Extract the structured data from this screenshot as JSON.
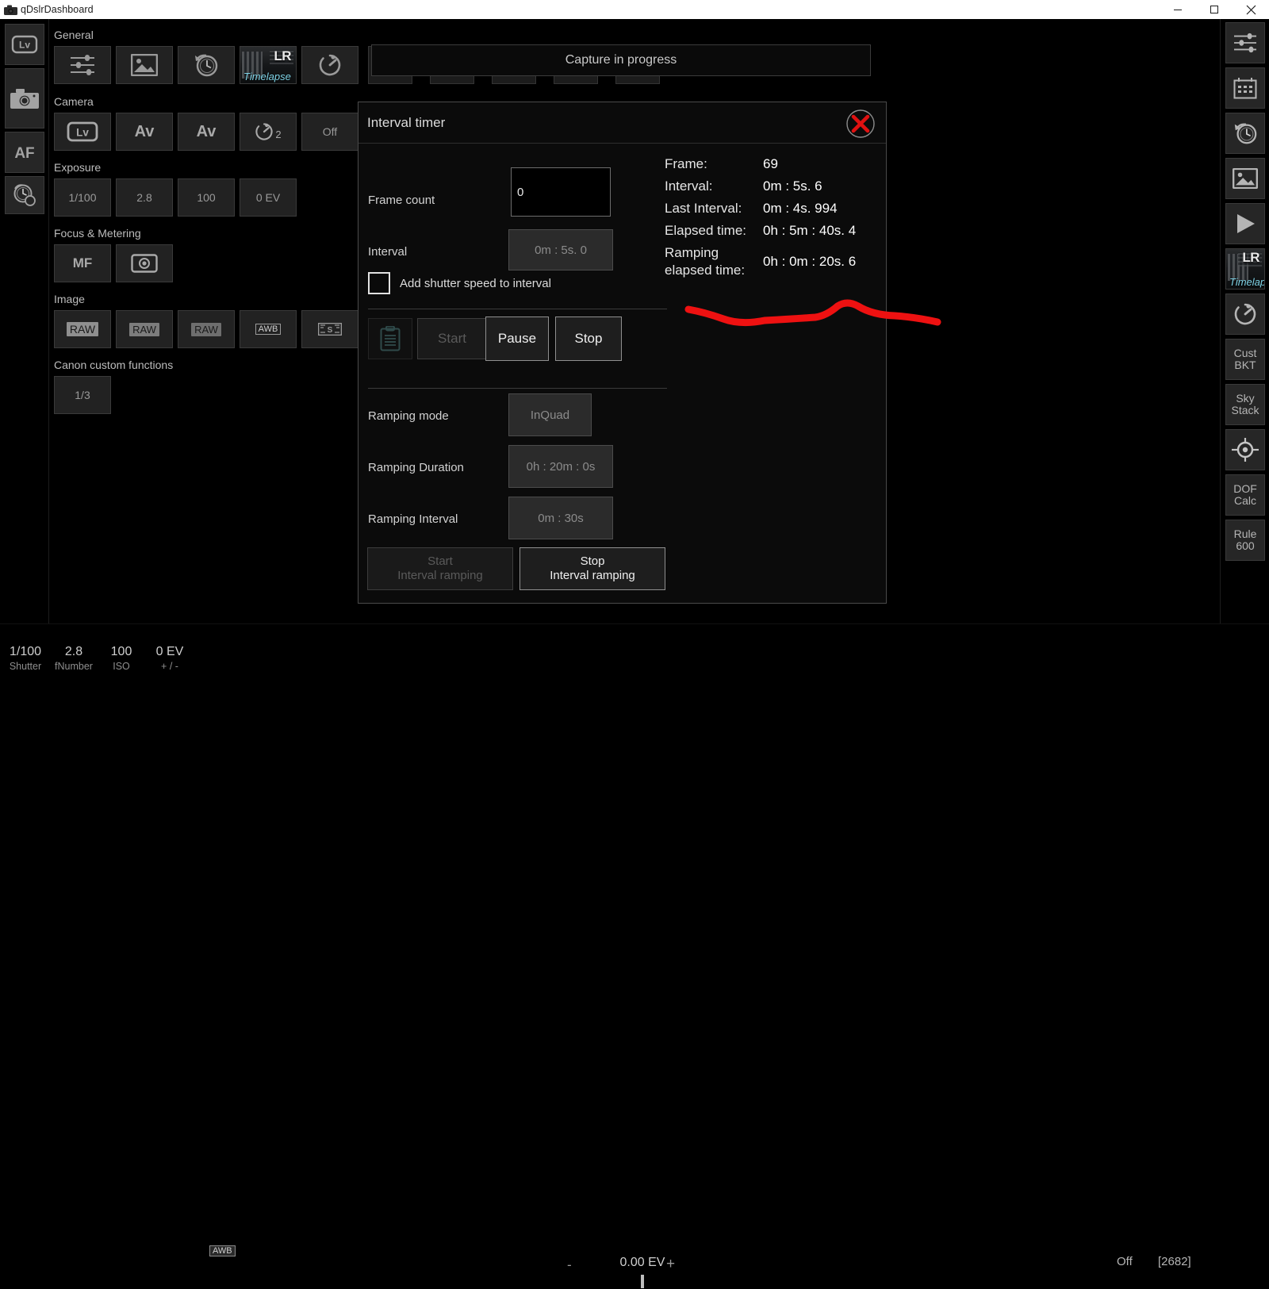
{
  "window": {
    "title": "qDslrDashboard",
    "icon": "camera-icon",
    "minimize": "─",
    "maximize": "❐",
    "close": "✕"
  },
  "banner": {
    "text": "Capture in progress"
  },
  "left_rail": [
    {
      "name": "lv-toggle",
      "label": "Lv",
      "icon": "lv-icon"
    },
    {
      "name": "camera-mode",
      "label": "",
      "icon": "camera-icon"
    },
    {
      "name": "af-toggle",
      "label": "AF",
      "icon": "af-icon"
    },
    {
      "name": "interval-timer",
      "label": "",
      "icon": "timer-clock-icon"
    }
  ],
  "groups": [
    {
      "label": "General",
      "tiles": [
        {
          "name": "sliders-tile",
          "label": "",
          "icon": "sliders-icon"
        },
        {
          "name": "gallery-tile",
          "label": "",
          "icon": "image-icon"
        },
        {
          "name": "interval-timer-tile",
          "label": "",
          "icon": "clock-arrow-icon"
        },
        {
          "name": "lrtimelapse-tile",
          "label": "LR",
          "sublabel": "Timelapse",
          "icon": "lrtimelapse-icon"
        },
        {
          "name": "self-timer-tile",
          "label": "",
          "icon": "self-timer-icon"
        }
      ]
    },
    {
      "label": "Camera",
      "tiles": [
        {
          "name": "liveview-tile",
          "label": "Lv",
          "icon": "lv-icon"
        },
        {
          "name": "mode-tile",
          "label": "Av"
        },
        {
          "name": "exposure-mode-tile",
          "label": "Av"
        },
        {
          "name": "drive-mode-tile",
          "label": "2",
          "icon": "self-timer-icon"
        },
        {
          "name": "aeb-tile",
          "label": "Off"
        }
      ]
    },
    {
      "label": "Exposure",
      "tiles": [
        {
          "name": "shutter-tile",
          "label": "1/100"
        },
        {
          "name": "aperture-tile",
          "label": "2.8"
        },
        {
          "name": "iso-tile",
          "label": "100"
        },
        {
          "name": "exposure-comp-tile",
          "label": "0 EV"
        }
      ]
    },
    {
      "label": "Focus & Metering",
      "tiles": [
        {
          "name": "focus-mode-tile",
          "label": "MF"
        },
        {
          "name": "metering-mode-tile",
          "label": "",
          "icon": "metering-icon"
        }
      ]
    },
    {
      "label": "Image",
      "tiles": [
        {
          "name": "image-quality-tile",
          "label": "RAW"
        },
        {
          "name": "image-quality2-tile",
          "label": "RAW"
        },
        {
          "name": "image-quality3-tile",
          "label": "RAW"
        },
        {
          "name": "white-balance-tile",
          "label": "AWB"
        },
        {
          "name": "picture-style-tile",
          "label": "",
          "icon": "picture-style-icon"
        }
      ]
    },
    {
      "label": "Canon custom functions",
      "tiles": [
        {
          "name": "custom-function-tile",
          "label": "1/3"
        }
      ]
    }
  ],
  "quick_tiles": [
    {
      "name": "cust-bkt-tile",
      "line1": "Cust",
      "line2": "BKT"
    },
    {
      "name": "sky-stack-tile",
      "line1": "Sky",
      "line2": "Stack"
    },
    {
      "name": "rule-600-tile",
      "line1": "Rule",
      "line2": "600"
    },
    {
      "name": "dof-calc-tile",
      "line1": "DOF",
      "line2": "Calc"
    },
    {
      "name": "audio-trigger-tile",
      "line1": "",
      "line2": "",
      "icon": "microphone-icon"
    }
  ],
  "right_rail": [
    {
      "name": "sliders-button",
      "line1": "",
      "line2": "",
      "icon": "sliders-icon"
    },
    {
      "name": "calendar-button",
      "line1": "",
      "line2": "",
      "icon": "calendar-icon"
    },
    {
      "name": "interval-timer-button",
      "line1": "",
      "line2": "",
      "icon": "clock-arrow-icon"
    },
    {
      "name": "gallery-button",
      "line1": "",
      "line2": "",
      "icon": "image-icon"
    },
    {
      "name": "play-button",
      "line1": "",
      "line2": "",
      "icon": "play-icon"
    },
    {
      "name": "lrtimelapse-button",
      "line1": "LR",
      "line2": "Timelapse",
      "icon": "lrtimelapse-icon"
    },
    {
      "name": "self-timer-button",
      "line1": "",
      "line2": "",
      "icon": "self-timer-icon"
    },
    {
      "name": "cust-bkt-button",
      "line1": "Cust",
      "line2": "BKT"
    },
    {
      "name": "sky-stack-button",
      "line1": "Sky",
      "line2": "Stack"
    },
    {
      "name": "focus-target-button",
      "line1": "",
      "line2": "",
      "icon": "crosshair-icon"
    },
    {
      "name": "dof-calc-button",
      "line1": "DOF",
      "line2": "Calc"
    },
    {
      "name": "rule-600-button",
      "line1": "Rule",
      "line2": "600"
    }
  ],
  "dialog": {
    "title": "Interval timer",
    "close_icon": "close-circle-icon",
    "frame_count": {
      "label": "Frame count",
      "value": "0",
      "placeholder": "0"
    },
    "interval": {
      "label": "Interval",
      "value": "0m : 5s. 0"
    },
    "add_shutter": {
      "label": "Add shutter speed to interval",
      "checked": false
    },
    "list_icon": "clipboard-list-icon",
    "buttons": {
      "start": "Start",
      "pause": "Pause",
      "stop": "Stop"
    },
    "ramping_mode": {
      "label": "Ramping mode",
      "value": "InQuad"
    },
    "ramping_duration": {
      "label": "Ramping Duration",
      "value": "0h : 20m : 0s"
    },
    "ramping_interval": {
      "label": "Ramping Interval",
      "value": "0m : 30s"
    },
    "ramp_buttons": {
      "start_line1": "Start",
      "start_line2": "Interval ramping",
      "stop_line1": "Stop",
      "stop_line2": "Interval ramping"
    },
    "readout": [
      {
        "key": "Frame:",
        "value": "69"
      },
      {
        "key": "Interval:",
        "value": "0m : 5s. 6"
      },
      {
        "key": "Last Interval:",
        "value": "0m : 4s. 994"
      },
      {
        "key": "Elapsed time:",
        "value": "0h : 5m : 40s. 4"
      },
      {
        "key": "Ramping",
        "key2": "elapsed time:",
        "value": "0h : 0m : 20s. 6"
      }
    ]
  },
  "statusbar": {
    "cells": [
      {
        "name": "shutter-status",
        "value": "1/100",
        "key": "Shutter"
      },
      {
        "name": "fnumber-status",
        "value": "2.8",
        "key": "fNumber"
      },
      {
        "name": "iso-status",
        "value": "100",
        "key": "ISO"
      },
      {
        "name": "ev-status",
        "value": "0 EV",
        "key": "+ / -"
      }
    ],
    "wb_chip": "AWB",
    "ev_minus": "-",
    "ev_value": "0.00 EV",
    "ev_plus": "+",
    "aeb": "Off",
    "shots_remaining": "[2682]"
  },
  "annotation": {
    "color": "#ee1111",
    "type": "freehand-underline"
  }
}
